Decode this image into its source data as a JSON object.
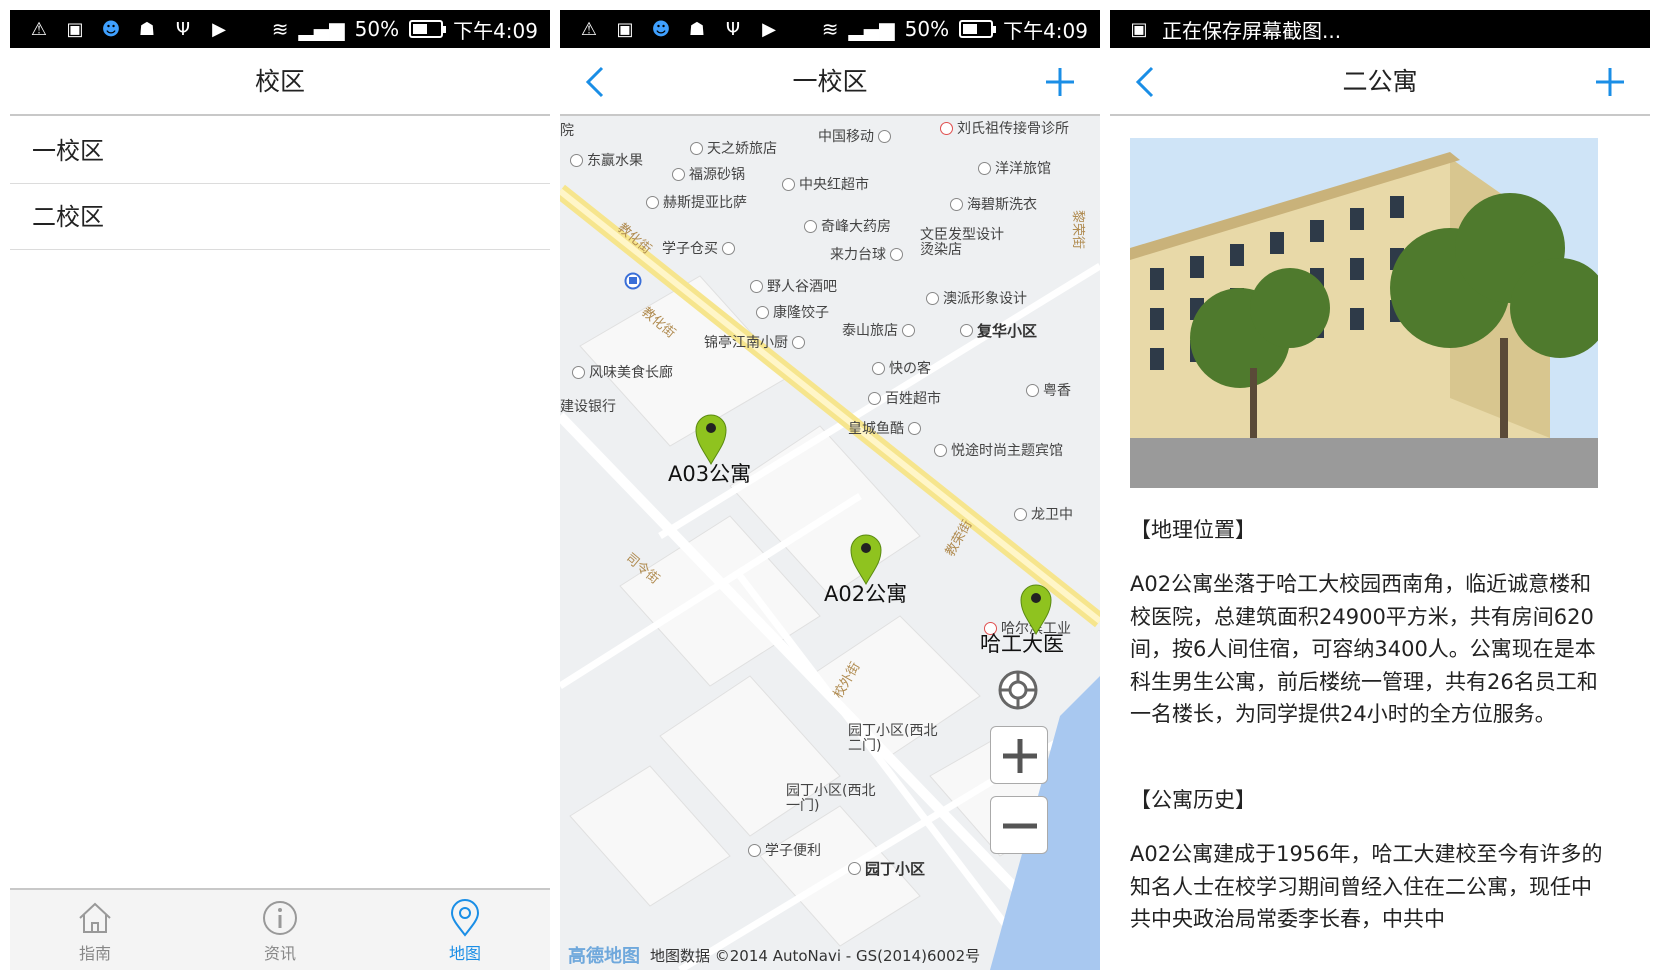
{
  "status_bar": {
    "battery": "50%",
    "time": "下午4:09",
    "saving_text": "正在保存屏幕截图..."
  },
  "campus_screen": {
    "title": "校区",
    "items": [
      {
        "label": "一校区"
      },
      {
        "label": "二校区"
      }
    ],
    "tabs": [
      {
        "label": "指南",
        "icon": "home-icon"
      },
      {
        "label": "资讯",
        "icon": "info-icon"
      },
      {
        "label": "地图",
        "icon": "map-pin-icon",
        "active": true
      }
    ]
  },
  "map_screen": {
    "title": "一校区",
    "markers": [
      {
        "label": "A03公寓"
      },
      {
        "label": "A02公寓"
      },
      {
        "label": "哈工大医"
      }
    ],
    "pois": [
      "东赢水果",
      "天之娇旅店",
      "中国移动",
      "刘氏祖传接骨诊所",
      "福源砂锅",
      "中央红超市",
      "洋洋旅馆",
      "赫斯提亚比萨",
      "海碧斯洗衣",
      "奇峰大药房",
      "学子仓买",
      "来力台球",
      "文臣发型设计烫染店",
      "野人谷酒吧",
      "康隆饺子",
      "澳派形象设计",
      "泰山旅店",
      "复华小区",
      "锦亭江南小厨",
      "风味美食长廊",
      "快の客",
      "建设银行",
      "百姓超市",
      "粤香",
      "皇城鱼酷",
      "悦途时尚主题宾馆",
      "龙卫中",
      "哈尔滨工业",
      "园丁小区(西北二门)",
      "园丁小区(西北一门)",
      "学子便利",
      "园丁小区",
      "院"
    ],
    "streets": [
      "教化街",
      "教化街",
      "司令街",
      "教荣街",
      "校外街",
      "黎荣街"
    ],
    "footer": {
      "logo": "高德地图",
      "copyright": "地图数据 ©2014 AutoNavi - GS(2014)6002号"
    }
  },
  "detail_screen": {
    "title": "二公寓",
    "section1_title": "【地理位置】",
    "section1_text": "A02公寓坐落于哈工大校园西南角，临近诚意楼和校医院，总建筑面积24900平方米，共有房间620间，按6人间住宿，可容纳3400人。公寓现在是本科生男生公寓，前后楼统一管理，共有26名员工和一名楼长，为同学提供24小时的全方位服务。",
    "section2_title": "【公寓历史】",
    "section2_text": "A02公寓建成于1956年，哈工大建校至今有许多的知名人士在校学习期间曾经入住在二公寓，现任中共中央政治局常委李长春，中共中"
  }
}
